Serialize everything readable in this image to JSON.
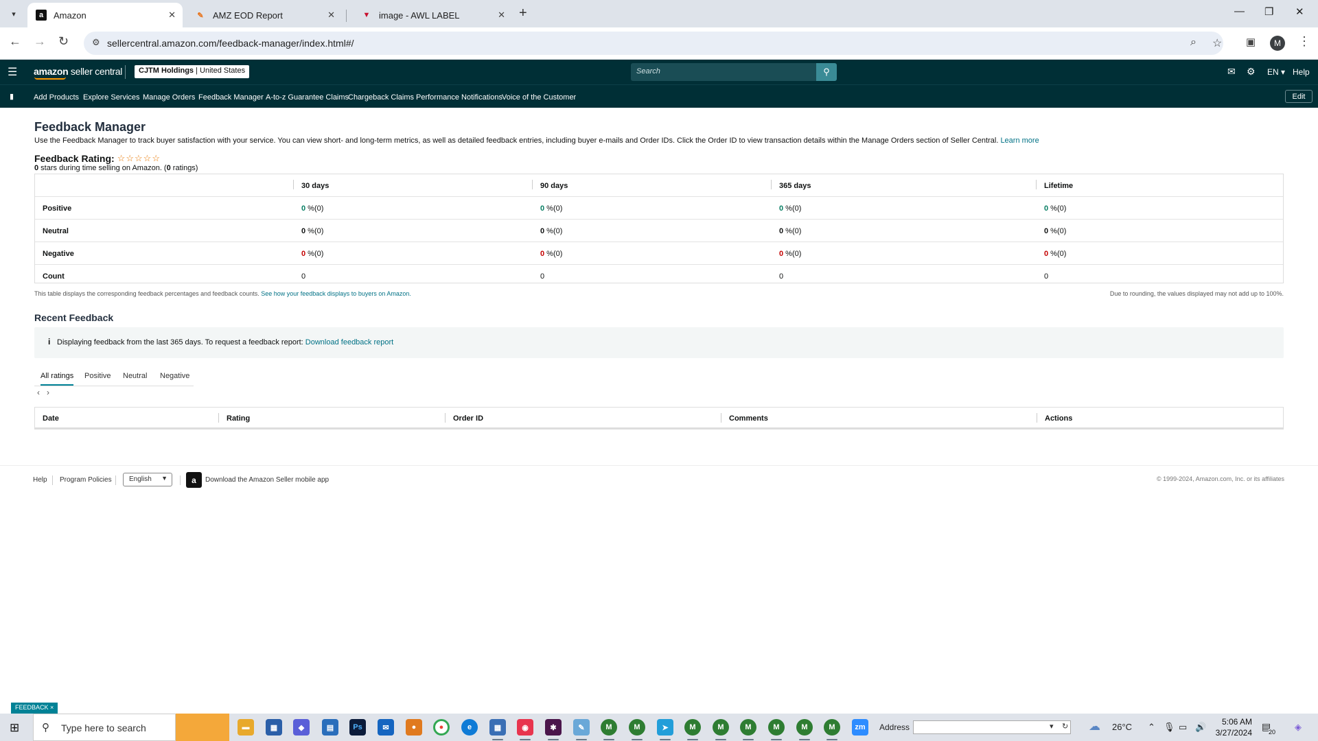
{
  "browser": {
    "tabs": [
      {
        "title": "Amazon",
        "favicon": "a"
      },
      {
        "title": "AMZ EOD Report",
        "favicon": "eod"
      },
      {
        "title": "image - AWL LABEL",
        "favicon": "v"
      }
    ],
    "url": "sellercentral.amazon.com/feedback-manager/index.html#/"
  },
  "header": {
    "logo_main": "amazon",
    "logo_sub": "seller central",
    "store_name": "CJTM Holdings",
    "store_region": "United States",
    "search_placeholder": "Search",
    "lang": "EN",
    "help": "Help"
  },
  "nav": {
    "links": [
      "Add Products",
      "Explore Services",
      "Manage Orders",
      "Feedback Manager",
      "A-to-z Guarantee Claims",
      "Chargeback Claims",
      "Performance Notifications",
      "Voice of the Customer"
    ],
    "edit": "Edit"
  },
  "page": {
    "title": "Feedback Manager",
    "intro": "Use the Feedback Manager to track buyer satisfaction with your service. You can view short- and long-term metrics, as well as detailed feedback entries, including buyer e-mails and Order IDs. Click the Order ID to view transaction details within the Manage Orders section of Seller Central.",
    "learn_more": "Learn more",
    "rating_label": "Feedback Rating:",
    "stars": "☆☆☆☆☆",
    "stars_count": "0",
    "stars_text": " stars during time selling on Amazon. (",
    "ratings_count": "0",
    "ratings_text": " ratings)"
  },
  "metrics": {
    "headers": [
      "30 days",
      "90 days",
      "365 days",
      "Lifetime"
    ],
    "rows": [
      {
        "label": "Positive",
        "values": [
          "0",
          "0",
          "0",
          "0"
        ],
        "suffix": " %(0)"
      },
      {
        "label": "Neutral",
        "values": [
          "0",
          "0",
          "0",
          "0"
        ],
        "suffix": " %(0)"
      },
      {
        "label": "Negative",
        "values": [
          "0",
          "0",
          "0",
          "0"
        ],
        "suffix": " %(0)"
      },
      {
        "label": "Count",
        "values": [
          "0",
          "0",
          "0",
          "0"
        ],
        "suffix": ""
      }
    ],
    "note_left": "This table displays the corresponding feedback percentages and feedback counts.",
    "note_left_link": "See how your feedback displays to buyers on Amazon.",
    "note_right": "Due to rounding, the values displayed may not add up to 100%."
  },
  "recent": {
    "title": "Recent Feedback",
    "info_text": "Displaying feedback from the last 365 days. To request a feedback report:",
    "info_link": "Download feedback report",
    "tabs": [
      "All ratings",
      "Positive",
      "Neutral",
      "Negative"
    ],
    "columns": [
      "Date",
      "Rating",
      "Order ID",
      "Comments",
      "Actions"
    ]
  },
  "footer": {
    "help": "Help",
    "policies": "Program Policies",
    "language": "English",
    "app_text": "Download the Amazon Seller mobile app",
    "copyright": "© 1999-2024, Amazon.com, Inc. or its affiliates"
  },
  "feedback_tab": "FEEDBACK ×",
  "taskbar": {
    "search_placeholder": "Type here to search",
    "address_label": "Address",
    "temperature": "26°C",
    "time": "5:06 AM",
    "date": "3/27/2024",
    "notifications": "20"
  },
  "colors": {
    "header_bg": "#002f36",
    "accent": "#008296",
    "positive": "#067d62",
    "negative": "#c40000",
    "stars": "#e77600"
  }
}
